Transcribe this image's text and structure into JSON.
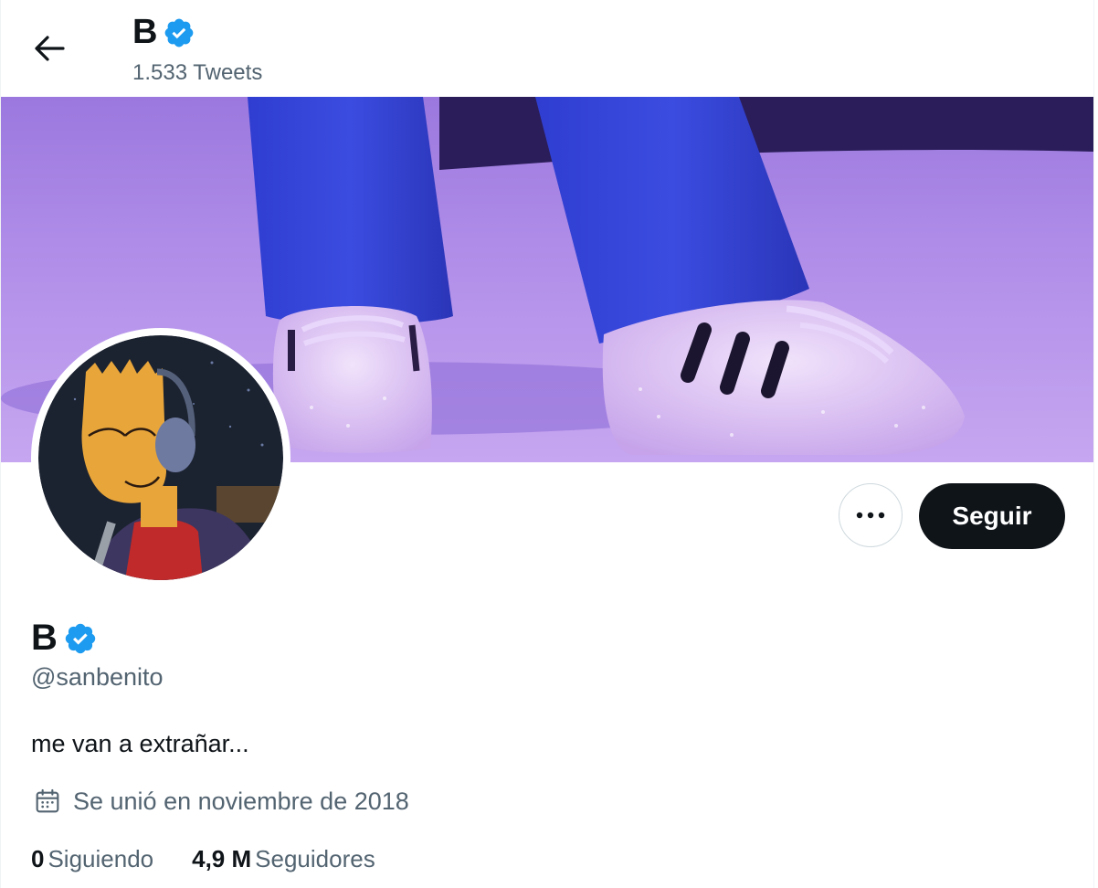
{
  "header": {
    "back_icon": "arrow-left-icon",
    "name": "B",
    "tweet_count": "1.533 Tweets"
  },
  "verified_color": "#1d9bf0",
  "banner": {
    "description_icon": "banner-image"
  },
  "actions": {
    "more_icon": "ellipsis-icon",
    "follow_label": "Seguir"
  },
  "profile": {
    "name": "B",
    "handle": "@sanbenito",
    "bio": "me van a extrañar...",
    "joined": "Se unió en noviembre de 2018",
    "following_count": "0",
    "following_label": "Siguiendo",
    "followers_count": "4,9 M",
    "followers_label": "Seguidores"
  }
}
